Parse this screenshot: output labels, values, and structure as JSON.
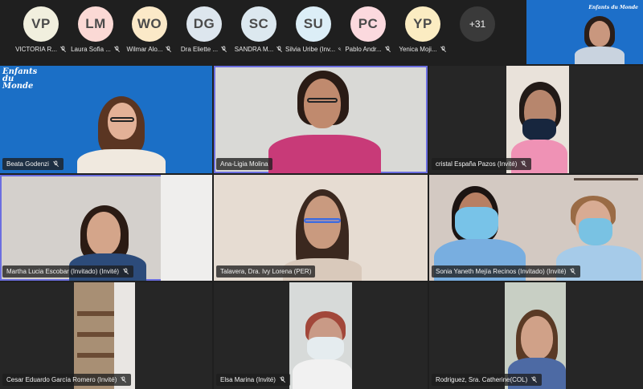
{
  "participants_strip": [
    {
      "initials": "VP",
      "name": "VICTORIA R...",
      "bg": "#f1efde",
      "fg": "#4b4b4b"
    },
    {
      "initials": "LM",
      "name": "Laura Sofia ...",
      "bg": "#fbd9d5",
      "fg": "#4b4b4b"
    },
    {
      "initials": "WO",
      "name": "Wilmar Alo...",
      "bg": "#fbe9c8",
      "fg": "#4b4b4b"
    },
    {
      "initials": "DG",
      "name": "Dra Eliette ...",
      "bg": "#dde6ee",
      "fg": "#4b4b4b"
    },
    {
      "initials": "SC",
      "name": "SANDRA M...",
      "bg": "#dce8ef",
      "fg": "#4b4b4b"
    },
    {
      "initials": "SU",
      "name": "Silvia Uribe (Inv...",
      "bg": "#dceef7",
      "fg": "#4b4b4b"
    },
    {
      "initials": "PC",
      "name": "Pablo Andr...",
      "bg": "#fbd9de",
      "fg": "#4b4b4b"
    },
    {
      "initials": "YP",
      "name": "Yenica Moji...",
      "bg": "#fbecc2",
      "fg": "#4b4b4b"
    }
  ],
  "more_count": "+31",
  "self_view": {
    "logo_text": "Enfants du Monde"
  },
  "tiles": [
    {
      "name": "Beata Godenzi",
      "logo": "Enfants du Monde"
    },
    {
      "name": "Ana-Ligia Molina"
    },
    {
      "name": "cristal España Pazos (Invité)"
    },
    {
      "name": "Martha Lucia Escobar (Invitado) (Invité)"
    },
    {
      "name": "Talavera, Dra. Ivy Lorena (PER)"
    },
    {
      "name": "Sonia Yaneth Mejía Recinos (Invitado) (Invité)"
    },
    {
      "name": "Cesar Eduardo García Romero (Invité)"
    },
    {
      "name": "Elsa Marina (Invité)"
    },
    {
      "name": "Rodriguez, Sra. Catherine(COL)"
    }
  ],
  "colors": {
    "app_bg": "#1f1f1f",
    "accent": "#6b6ee0",
    "brand_blue": "#1d6fc9"
  },
  "icons": {
    "mic": "mic-muted-icon"
  }
}
